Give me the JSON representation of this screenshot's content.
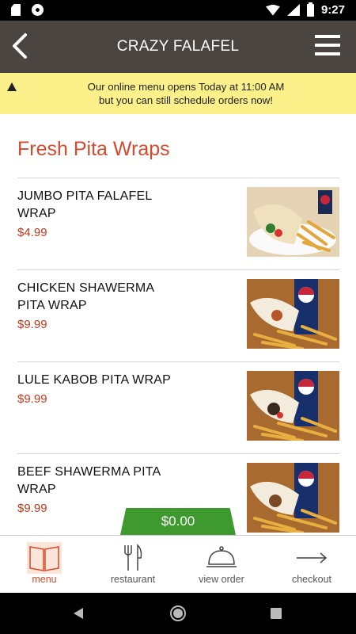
{
  "status_bar": {
    "time": "9:27",
    "icons": [
      "sd-card-icon",
      "sync-icon",
      "wifi-icon",
      "signal-icon",
      "battery-icon"
    ]
  },
  "header": {
    "title": "CRAZY FALAFEL",
    "back_icon": "chevron-left-icon",
    "menu_icon": "hamburger-menu-icon"
  },
  "notice": {
    "icon": "warning-icon",
    "line1": "Our online menu opens Today at 11:00 AM",
    "line2": "but you can still schedule orders now!"
  },
  "section": {
    "title": "Fresh Pita Wraps"
  },
  "items": [
    {
      "name_line1": "JUMBO PITA FALAFEL",
      "name_line2": "WRAP",
      "price": "$4.99"
    },
    {
      "name_line1": "CHICKEN SHAWERMA",
      "name_line2": "PITA WRAP",
      "price": "$9.99"
    },
    {
      "name_line1": "LULE KABOB PITA WRAP",
      "name_line2": "",
      "price": "$9.99"
    },
    {
      "name_line1": "BEEF SHAWERMA PITA",
      "name_line2": "WRAP",
      "price": "$9.99"
    }
  ],
  "cart": {
    "total": "$0.00"
  },
  "bottom_nav": [
    {
      "label": "menu",
      "icon": "book-icon",
      "active": true
    },
    {
      "label": "restaurant",
      "icon": "fork-knife-icon",
      "active": false
    },
    {
      "label": "view order",
      "icon": "cloche-icon",
      "active": false
    },
    {
      "label": "checkout",
      "icon": "arrow-right-icon",
      "active": false
    }
  ],
  "colors": {
    "header_bg": "#4a4540",
    "notice_bg": "#fbf08a",
    "accent": "#d44a2e",
    "price": "#c2391d",
    "cart_green": "#3e9a2f"
  }
}
